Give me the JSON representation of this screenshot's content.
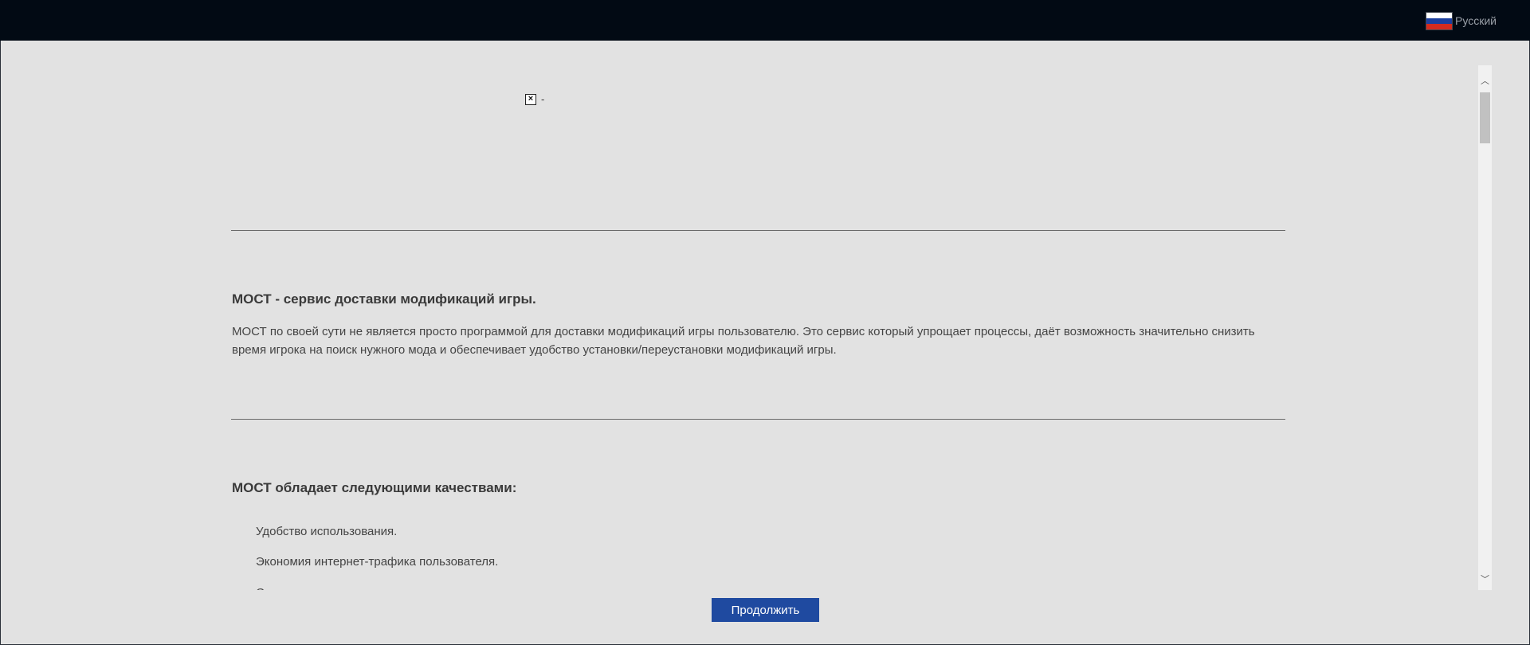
{
  "header": {
    "language_label": "Русский",
    "flag_icon": "russia-flag-icon"
  },
  "content": {
    "broken_image_icon": "broken-image-icon",
    "broken_image_dash": "-",
    "section1": {
      "title": "МОСТ - сервис доставки модификаций игры.",
      "body": "МОСТ по своей сути не является просто программой для доставки модификаций игры пользователю. Это сервис который упрощает процессы, даёт возможность значительно снизить время игрока на поиск нужного мода и обеспечивает удобство установки/переустановки модификаций игры."
    },
    "section2": {
      "title": "МОСТ обладает следующими качествами:",
      "items": [
        "Удобство использования.",
        "Экономия интернет-трафика пользователя.",
        "С"
      ]
    }
  },
  "footer": {
    "continue_label": "Продолжить"
  },
  "colors": {
    "topbar": "#020a14",
    "background": "#e2e2e2",
    "button": "#1f4aa0"
  }
}
